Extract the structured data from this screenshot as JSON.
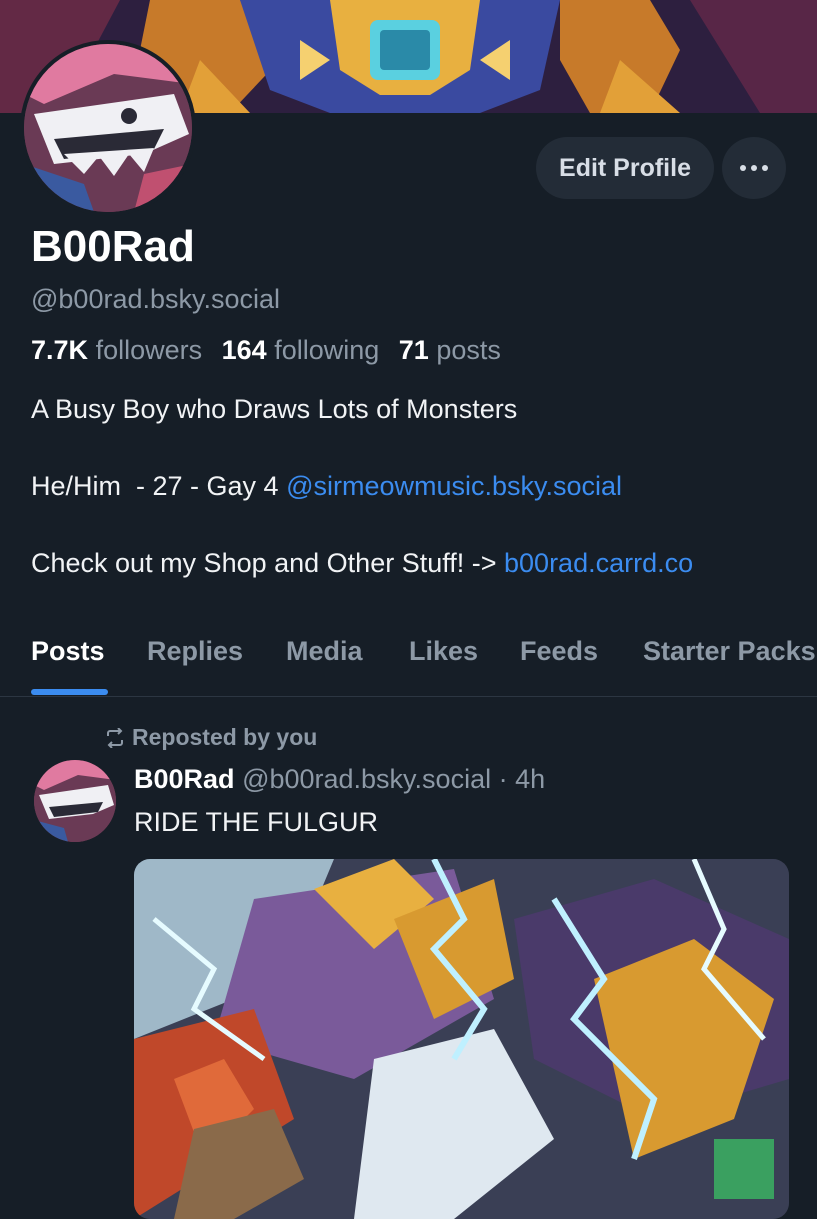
{
  "profile": {
    "display_name": "B00Rad",
    "handle": "@b00rad.bsky.social",
    "followers_count": "7.7K",
    "followers_label": "followers",
    "following_count": "164",
    "following_label": "following",
    "posts_count": "71",
    "posts_label": "posts",
    "bio_line1": "A Busy Boy who Draws Lots of Monsters",
    "bio_line2_text": "He/Him  - 27 - Gay 4 ",
    "bio_line2_link": "@sirmeowmusic.bsky.social",
    "bio_line3_text": "Check out my Shop and Other Stuff! -> ",
    "bio_line3_link": "b00rad.carrd.co"
  },
  "actions": {
    "edit_label": "Edit Profile",
    "more_icon": "ellipsis-icon"
  },
  "tabs": [
    {
      "label": "Posts"
    },
    {
      "label": "Replies"
    },
    {
      "label": "Media"
    },
    {
      "label": "Likes"
    },
    {
      "label": "Feeds"
    },
    {
      "label": "Starter Packs"
    }
  ],
  "post": {
    "repost_label": "Reposted by you",
    "author_name": "B00Rad",
    "author_handle": "@b00rad.bsky.social",
    "separator": "·",
    "time": "4h",
    "text": "RIDE THE FULGUR"
  },
  "colors": {
    "background": "#161e27",
    "accent": "#3b8cf0",
    "muted": "#8d99a6",
    "button": "#232c37"
  }
}
